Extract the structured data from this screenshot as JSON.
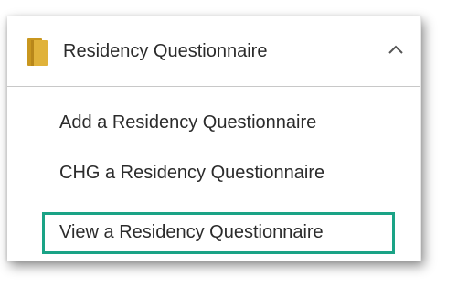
{
  "header": {
    "title": "Residency Questionnaire",
    "icon": "folder-icon",
    "toggle_icon": "chevron-up-icon"
  },
  "menu": {
    "items": [
      {
        "label": "Add a Residency Questionnaire"
      },
      {
        "label": "CHG a Residency Questionnaire"
      },
      {
        "label": "View a Residency Questionnaire",
        "highlighted": true
      }
    ]
  },
  "colors": {
    "highlight_border": "#1aa386",
    "folder": "#d4a52a",
    "text": "#2b2b2b"
  }
}
